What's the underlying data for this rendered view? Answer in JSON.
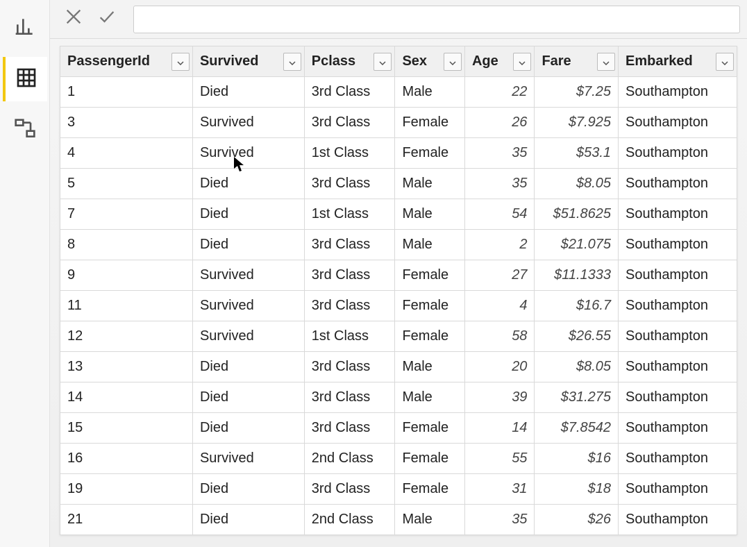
{
  "sidebar": {
    "items": [
      "report-view-icon",
      "data-view-icon",
      "model-view-icon"
    ],
    "active_index": 1
  },
  "formula_bar": {
    "cancel_tooltip": "Cancel",
    "commit_tooltip": "Commit",
    "value": ""
  },
  "table": {
    "columns": [
      {
        "key": "passenger_id",
        "label": "PassengerId",
        "align": "txt",
        "class": "col-pid"
      },
      {
        "key": "survived",
        "label": "Survived",
        "align": "txt",
        "class": "col-survived"
      },
      {
        "key": "pclass",
        "label": "Pclass",
        "align": "txt",
        "class": "col-pclass"
      },
      {
        "key": "sex",
        "label": "Sex",
        "align": "txt",
        "class": "col-sex"
      },
      {
        "key": "age",
        "label": "Age",
        "align": "num",
        "class": "col-age"
      },
      {
        "key": "fare",
        "label": "Fare",
        "align": "num",
        "class": "col-fare"
      },
      {
        "key": "embarked",
        "label": "Embarked",
        "align": "txt",
        "class": "col-embarked"
      }
    ],
    "rows": [
      {
        "passenger_id": "1",
        "survived": "Died",
        "pclass": "3rd Class",
        "sex": "Male",
        "age": "22",
        "fare": "$7.25",
        "embarked": "Southampton"
      },
      {
        "passenger_id": "3",
        "survived": "Survived",
        "pclass": "3rd Class",
        "sex": "Female",
        "age": "26",
        "fare": "$7.925",
        "embarked": "Southampton"
      },
      {
        "passenger_id": "4",
        "survived": "Survived",
        "pclass": "1st Class",
        "sex": "Female",
        "age": "35",
        "fare": "$53.1",
        "embarked": "Southampton"
      },
      {
        "passenger_id": "5",
        "survived": "Died",
        "pclass": "3rd Class",
        "sex": "Male",
        "age": "35",
        "fare": "$8.05",
        "embarked": "Southampton"
      },
      {
        "passenger_id": "7",
        "survived": "Died",
        "pclass": "1st Class",
        "sex": "Male",
        "age": "54",
        "fare": "$51.8625",
        "embarked": "Southampton"
      },
      {
        "passenger_id": "8",
        "survived": "Died",
        "pclass": "3rd Class",
        "sex": "Male",
        "age": "2",
        "fare": "$21.075",
        "embarked": "Southampton"
      },
      {
        "passenger_id": "9",
        "survived": "Survived",
        "pclass": "3rd Class",
        "sex": "Female",
        "age": "27",
        "fare": "$11.1333",
        "embarked": "Southampton"
      },
      {
        "passenger_id": "11",
        "survived": "Survived",
        "pclass": "3rd Class",
        "sex": "Female",
        "age": "4",
        "fare": "$16.7",
        "embarked": "Southampton"
      },
      {
        "passenger_id": "12",
        "survived": "Survived",
        "pclass": "1st Class",
        "sex": "Female",
        "age": "58",
        "fare": "$26.55",
        "embarked": "Southampton"
      },
      {
        "passenger_id": "13",
        "survived": "Died",
        "pclass": "3rd Class",
        "sex": "Male",
        "age": "20",
        "fare": "$8.05",
        "embarked": "Southampton"
      },
      {
        "passenger_id": "14",
        "survived": "Died",
        "pclass": "3rd Class",
        "sex": "Male",
        "age": "39",
        "fare": "$31.275",
        "embarked": "Southampton"
      },
      {
        "passenger_id": "15",
        "survived": "Died",
        "pclass": "3rd Class",
        "sex": "Female",
        "age": "14",
        "fare": "$7.8542",
        "embarked": "Southampton"
      },
      {
        "passenger_id": "16",
        "survived": "Survived",
        "pclass": "2nd Class",
        "sex": "Female",
        "age": "55",
        "fare": "$16",
        "embarked": "Southampton"
      },
      {
        "passenger_id": "19",
        "survived": "Died",
        "pclass": "3rd Class",
        "sex": "Female",
        "age": "31",
        "fare": "$18",
        "embarked": "Southampton"
      },
      {
        "passenger_id": "21",
        "survived": "Died",
        "pclass": "2nd Class",
        "sex": "Male",
        "age": "35",
        "fare": "$26",
        "embarked": "Southampton"
      }
    ]
  }
}
